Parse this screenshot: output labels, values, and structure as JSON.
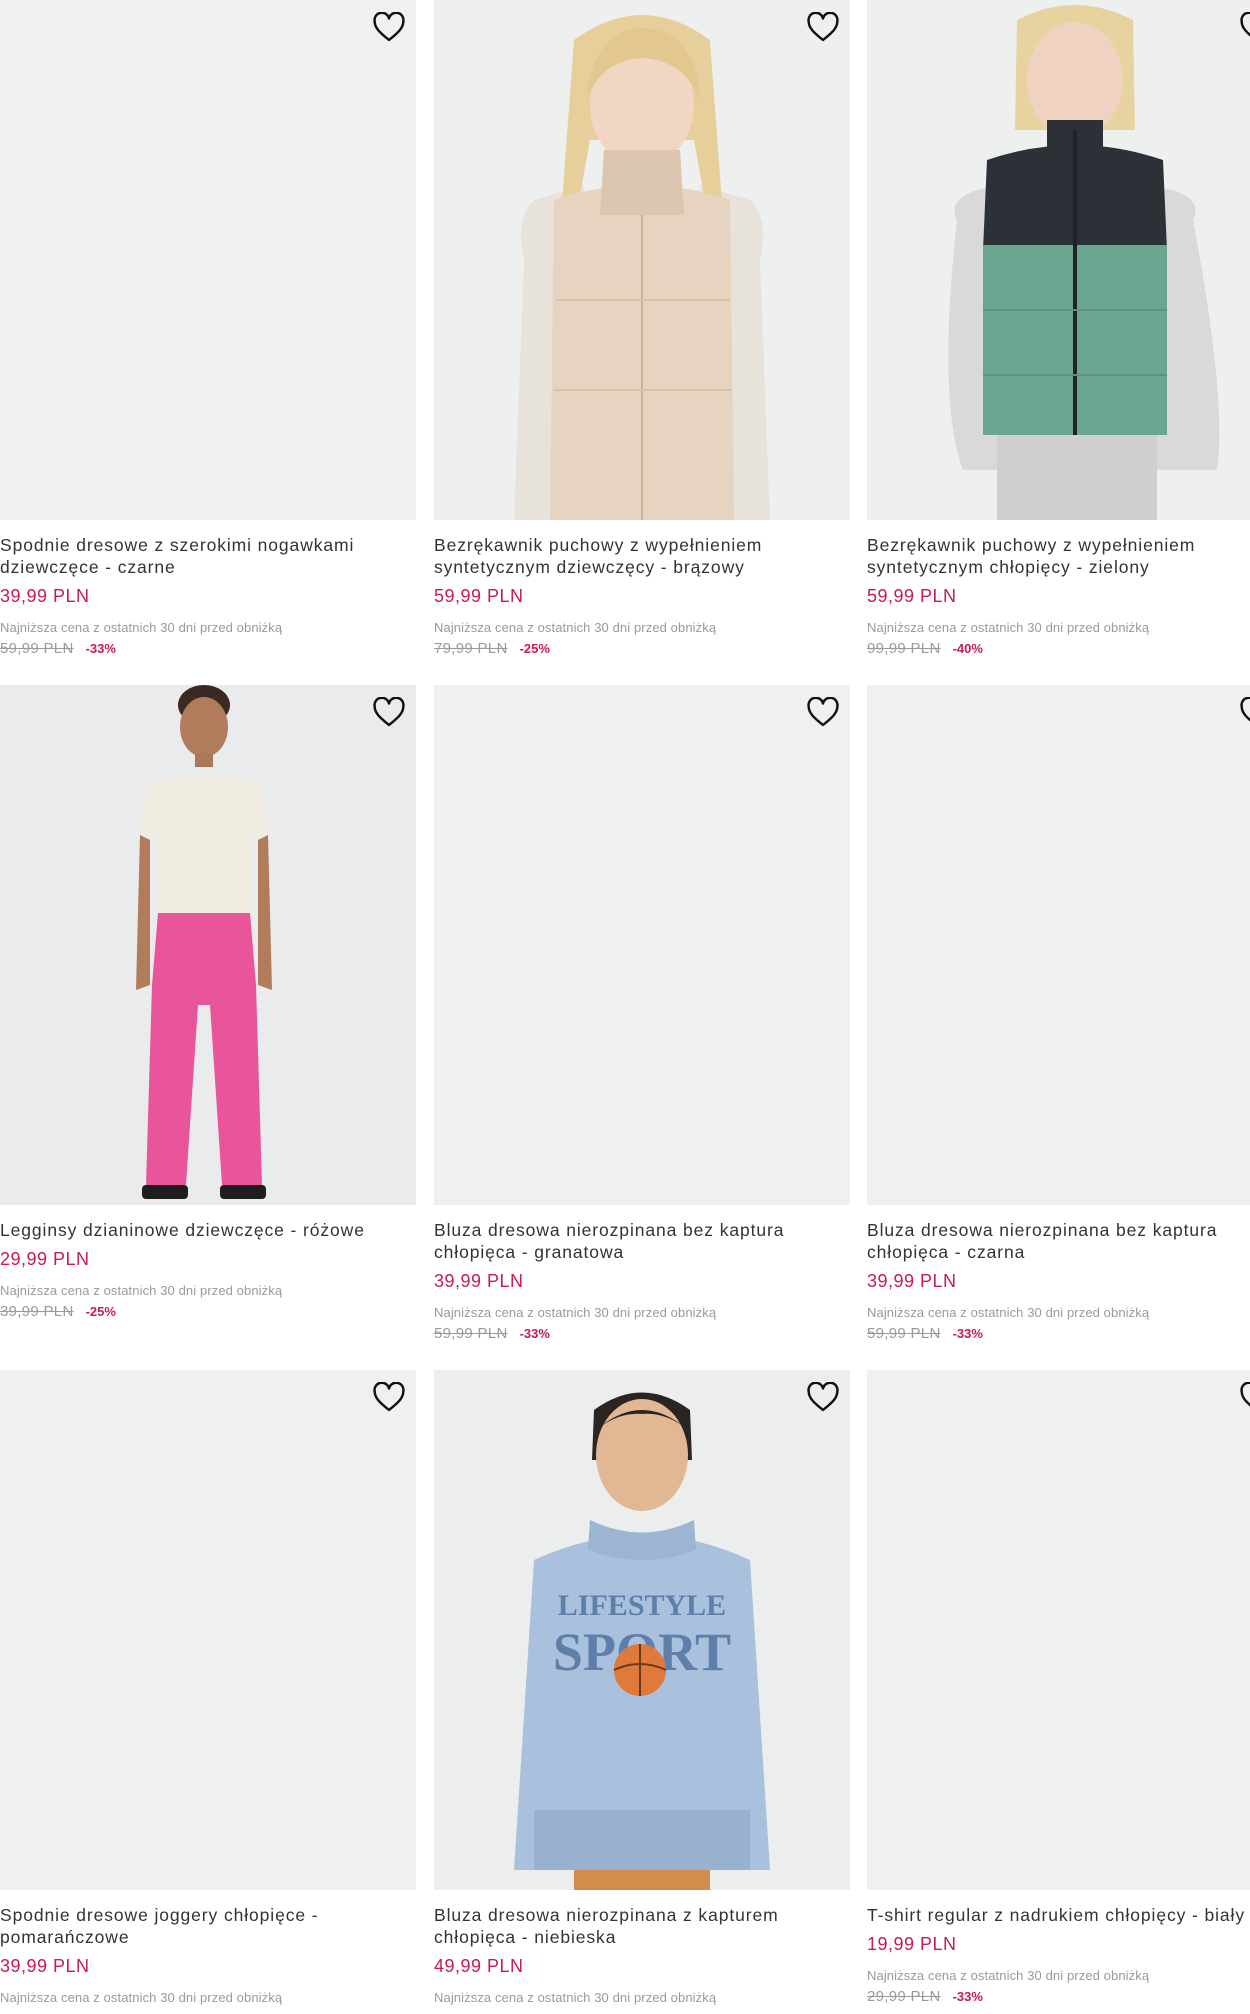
{
  "products": [
    {
      "name": "Spodnie dresowe z szerokimi nogawkami dziewczęce - czarne",
      "name_lines": [
        "Spodnie dresowe z szerokimi nogawkami",
        "dziewczęce - czarne"
      ],
      "price": "39,99 PLN",
      "lowest_label": "Najniższa cena z ostatnich 30 dni przed obniżką",
      "old_price": "59,99 PLN",
      "discount": "-33%"
    },
    {
      "name": "Bezrękawnik puchowy z wypełnieniem syntetycznym dziewczęcy - brązowy",
      "name_lines": [
        "Bezrękawnik puchowy z wypełnieniem",
        "syntetycznym dziewczęcy - brązowy"
      ],
      "price": "59,99 PLN",
      "lowest_label": "Najniższa cena z ostatnich 30 dni przed obniżką",
      "old_price": "79,99 PLN",
      "discount": "-25%"
    },
    {
      "name": "Bezrękawnik puchowy z wypełnieniem syntetycznym chłopięcy - zielony",
      "name_lines": [
        "Bezrękawnik puchowy z wypełnieniem",
        "syntetycznym chłopięcy - zielony"
      ],
      "price": "59,99 PLN",
      "lowest_label": "Najniższa cena z ostatnich 30 dni przed obniżką",
      "old_price": "99,99 PLN",
      "discount": "-40%"
    },
    {
      "name": "Legginsy dzianinowe dziewczęce - różowe",
      "name_lines": [
        "Legginsy dzianinowe dziewczęce - różowe",
        ""
      ],
      "price": "29,99 PLN",
      "lowest_label": "Najniższa cena z ostatnich 30 dni przed obniżką",
      "old_price": "39,99 PLN",
      "discount": "-25%"
    },
    {
      "name": "Bluza dresowa nierozpinana bez kaptura chłopięca - granatowa",
      "name_lines": [
        "Bluza dresowa nierozpinana bez kaptura",
        "chłopięca - granatowa"
      ],
      "price": "39,99 PLN",
      "lowest_label": "Najniższa cena z ostatnich 30 dni przed obniżką",
      "old_price": "59,99 PLN",
      "discount": "-33%"
    },
    {
      "name": "Bluza dresowa nierozpinana bez kaptura chłopięca - czarna",
      "name_lines": [
        "Bluza dresowa nierozpinana bez kaptura",
        "chłopięca - czarna"
      ],
      "price": "39,99 PLN",
      "lowest_label": "Najniższa cena z ostatnich 30 dni przed obniżką",
      "old_price": "59,99 PLN",
      "discount": "-33%"
    },
    {
      "name": "Spodnie dresowe joggery chłopięce - pomarańczowe",
      "name_lines": [
        "Spodnie dresowe joggery chłopięce -",
        "pomarańczowe"
      ],
      "price": "39,99 PLN",
      "lowest_label": "Najniższa cena z ostatnich 30 dni przed obniżką",
      "old_price": "",
      "discount": ""
    },
    {
      "name": "Bluza dresowa nierozpinana z kapturem chłopięca - niebieska",
      "name_lines": [
        "Bluza dresowa nierozpinana z kapturem",
        "chłopięca - niebieska"
      ],
      "price": "49,99 PLN",
      "lowest_label": "Najniższa cena z ostatnich 30 dni przed obniżką",
      "old_price": "",
      "discount": ""
    },
    {
      "name": "T-shirt regular z nadrukiem chłopięcy - biały",
      "name_lines": [
        "T-shirt regular z nadrukiem chłopięcy - biały",
        ""
      ],
      "price": "19,99 PLN",
      "lowest_label": "Najniższa cena z ostatnich 30 dni przed obniżką",
      "old_price": "29,99 PLN",
      "discount": "-33%"
    }
  ],
  "hoodie_print": {
    "line1": "LIFESTYLE",
    "line2": "SPORT"
  },
  "icons": {
    "favorite": "heart-outline-icon"
  },
  "colors": {
    "price": "#c8195a",
    "muted": "#9a9a9a",
    "photo_bg": "#eff0ef"
  }
}
